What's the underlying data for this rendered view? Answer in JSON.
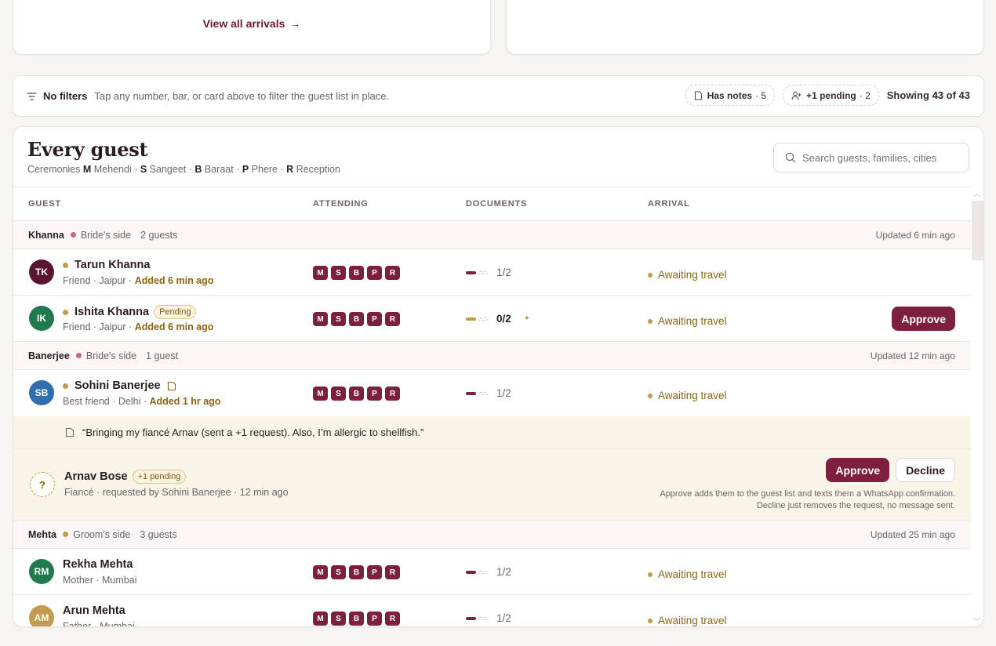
{
  "arrivals_card": {
    "view_all_label": "View all arrivals",
    "arrow": "→"
  },
  "filter_bar": {
    "title": "No filters",
    "hint": "Tap any number, bar, or card above to filter the guest list in place.",
    "chips": [
      {
        "label": "Has notes",
        "count": "· 5"
      },
      {
        "label": "+1 pending",
        "count": "· 2"
      }
    ],
    "showing_prefix": "Showing",
    "showing_count": "43",
    "showing_of": "of 43"
  },
  "panel": {
    "title": "Every guest",
    "legend": {
      "prefix": "Ceremonies",
      "items": [
        {
          "key": "M",
          "label": "Mehendi"
        },
        {
          "key": "S",
          "label": "Sangeet"
        },
        {
          "key": "B",
          "label": "Baraat"
        },
        {
          "key": "P",
          "label": "Phere"
        },
        {
          "key": "R",
          "label": "Reception"
        }
      ]
    },
    "search_placeholder": "Search guests, families, cities"
  },
  "columns": {
    "guest": "GUEST",
    "attending": "ATTENDING",
    "documents": "DOCUMENTS",
    "arrival": "ARRIVAL"
  },
  "ceremony_keys": [
    "M",
    "S",
    "B",
    "P",
    "R"
  ],
  "colors": {
    "brand": "#7d1f3e",
    "gold": "#c49a4f",
    "bride_side": "#c9657f",
    "groom_side": "#c49a4f"
  },
  "groups": [
    {
      "name": "Khanna",
      "side": "Bride's side",
      "count": "2 guests",
      "updated": "Updated 6 min ago",
      "guests": [
        {
          "initials": "TK",
          "avatar_color": "#5c1530",
          "name": "Tarun Khanna",
          "meta": "Friend · Jaipur · ",
          "added": "Added 6 min ago",
          "docs": "1/2",
          "arrival": "Awaiting travel"
        },
        {
          "initials": "IK",
          "avatar_color": "#1f7a4d",
          "name": "Ishita Khanna",
          "badge": "Pending",
          "meta": "Friend · Jaipur · ",
          "added": "Added 6 min ago",
          "docs": "0/2",
          "arrival": "Awaiting travel",
          "action": "Approve"
        }
      ]
    },
    {
      "name": "Banerjee",
      "side": "Bride's side",
      "count": "1 guest",
      "updated": "Updated 12 min ago",
      "guests": [
        {
          "initials": "SB",
          "avatar_color": "#2f6eaf",
          "name": "Sohini Banerjee",
          "meta": "Best friend · Delhi · ",
          "added": "Added 1 hr ago",
          "docs": "1/2",
          "arrival": "Awaiting travel",
          "note": "“Bringing my fiancé Arnav (sent a +1 request). Also, I’m allergic to shellfish.”"
        }
      ],
      "request": {
        "initials": "?",
        "name": "Arnav Bose",
        "badge": "+1 pending",
        "meta": "Fiancé · requested by Sohini Banerjee · 12 min ago",
        "approve": "Approve",
        "decline": "Decline",
        "help_1": "Approve adds them to the guest list and texts them a WhatsApp confirmation.",
        "help_2": "Decline just removes the request, no message sent."
      }
    },
    {
      "name": "Mehta",
      "side": "Groom's side",
      "count": "3 guests",
      "updated": "Updated 25 min ago",
      "guests": [
        {
          "initials": "RM",
          "avatar_color": "#1f7a4d",
          "name": "Rekha Mehta",
          "meta": "Mother · Mumbai",
          "docs": "1/2",
          "arrival": "Awaiting travel"
        },
        {
          "initials": "AM",
          "avatar_color": "#c49a4f",
          "name": "Arun Mehta",
          "meta": "Father · Mumbai",
          "docs": "1/2",
          "arrival": "Awaiting travel"
        }
      ]
    }
  ]
}
